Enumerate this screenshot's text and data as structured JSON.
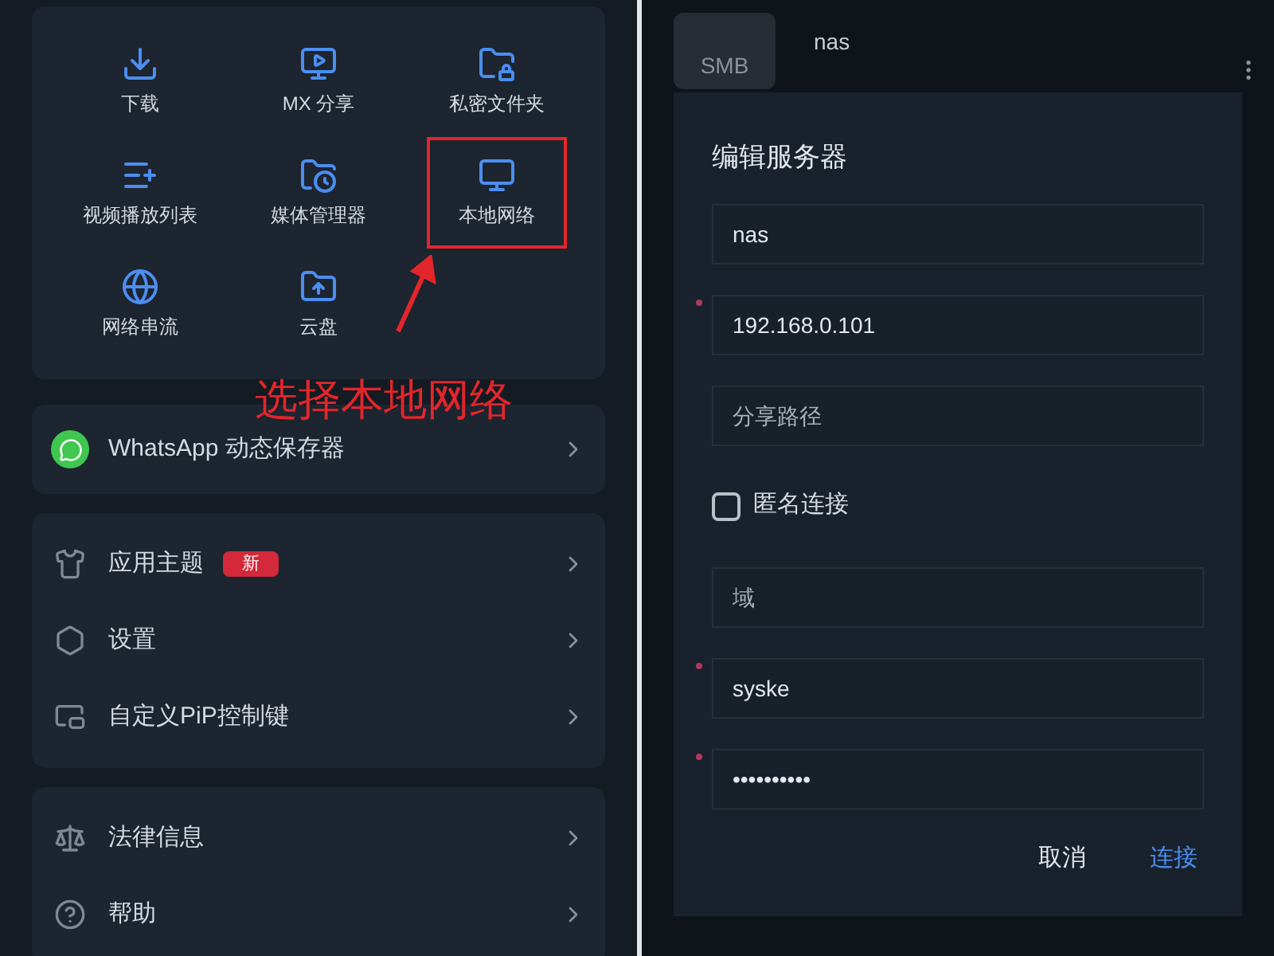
{
  "left_panel": {
    "grid": [
      {
        "label": "下载",
        "highlighted": false
      },
      {
        "label": "MX 分享",
        "highlighted": false
      },
      {
        "label": "私密文件夹",
        "highlighted": false
      },
      {
        "label": "视频播放列表",
        "highlighted": false
      },
      {
        "label": "媒体管理器",
        "highlighted": false
      },
      {
        "label": "本地网络",
        "highlighted": true
      },
      {
        "label": "网络串流",
        "highlighted": false
      },
      {
        "label": "云盘",
        "highlighted": false
      }
    ],
    "annotation": {
      "text": "选择本地网络"
    },
    "menu_groups": [
      [
        {
          "label": "WhatsApp 动态保存器"
        }
      ],
      [
        {
          "label": "应用主题",
          "badge": "新"
        },
        {
          "label": "设置"
        },
        {
          "label": "自定义PiP控制键"
        }
      ],
      [
        {
          "label": "法律信息"
        },
        {
          "label": "帮助"
        }
      ]
    ]
  },
  "right_panel": {
    "header": {
      "folder_label": "SMB",
      "title": "nas"
    },
    "dialog": {
      "title": "编辑服务器",
      "fields": [
        {
          "kind": "field",
          "value": "nas",
          "required": false
        },
        {
          "kind": "field",
          "value": "192.168.0.101",
          "required": true
        },
        {
          "kind": "field",
          "placeholder": "分享路径",
          "required": false
        },
        {
          "kind": "checkbox",
          "label": "匿名连接",
          "checked": false
        },
        {
          "kind": "field",
          "placeholder": "域",
          "required": false
        },
        {
          "kind": "field",
          "value": "syske",
          "required": true
        },
        {
          "kind": "field",
          "value": "••••••••••",
          "required": true
        }
      ],
      "buttons": [
        {
          "label": "取消",
          "primary": false
        },
        {
          "label": "连接",
          "primary": true
        }
      ]
    }
  }
}
